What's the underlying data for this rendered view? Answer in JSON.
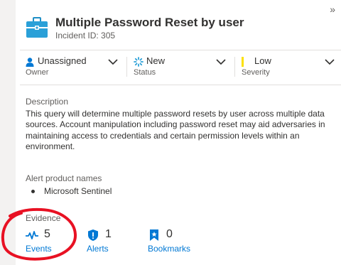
{
  "header": {
    "title": "Multiple Password Reset by user",
    "incident_id": "Incident ID: 305",
    "expand_glyph": "»"
  },
  "fields": {
    "owner": {
      "value": "Unassigned",
      "label": "Owner"
    },
    "status": {
      "value": "New",
      "label": "Status"
    },
    "severity": {
      "value": "Low",
      "label": "Severity"
    }
  },
  "description": {
    "label": "Description",
    "text": "This query will determine multiple password resets by user across multiple data sources. Account manipulation including password reset may aid adversaries in maintaining access to credentials and certain permission levels within an environment."
  },
  "alert_products": {
    "label": "Alert product names",
    "items": [
      "Microsoft Sentinel"
    ]
  },
  "evidence": {
    "label": "Evidence",
    "events": {
      "count": "5",
      "label": "Events"
    },
    "alerts": {
      "count": "1",
      "label": "Alerts"
    },
    "bookmarks": {
      "count": "0",
      "label": "Bookmarks"
    }
  },
  "colors": {
    "accent": "#0078d4",
    "severity_low": "#fce100",
    "annotation": "#e81123",
    "case_icon": "#2aa0d8"
  },
  "icons": [
    "briefcase-icon",
    "person-icon",
    "spinner-icon",
    "chevron-down-icon",
    "pulse-icon",
    "shield-alert-icon",
    "bookmark-icon",
    "expand-icon"
  ]
}
